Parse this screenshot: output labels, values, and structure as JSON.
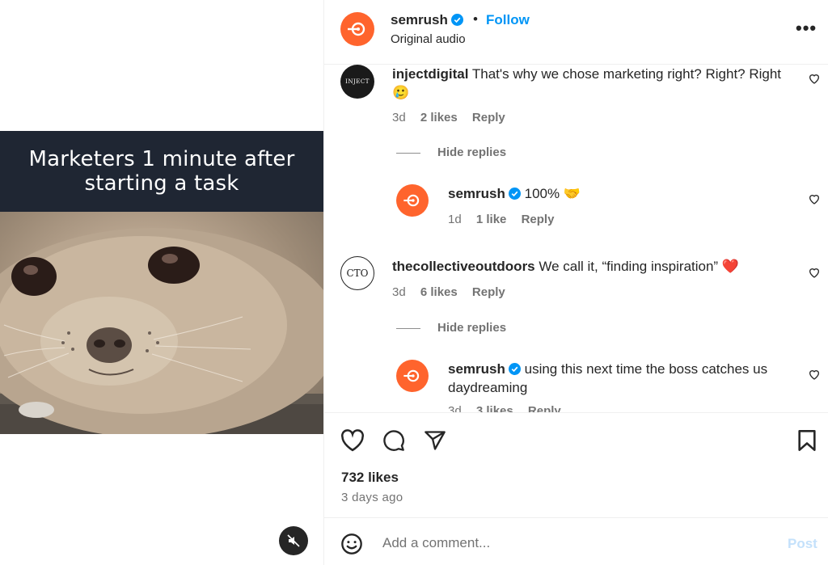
{
  "media": {
    "caption": "Marketers 1 minute after starting a task"
  },
  "header": {
    "username": "semrush",
    "separator": "•",
    "follow_label": "Follow",
    "subtitle": "Original audio",
    "more_label": "•••"
  },
  "comments": [
    {
      "username": "injectdigital",
      "avatar_text": "INJECT",
      "text": "That's why we chose marketing right? Right? Right 🥲",
      "time": "3d",
      "likes": "2 likes",
      "reply_label": "Reply",
      "hide_replies": "Hide replies",
      "replies": [
        {
          "username": "semrush",
          "text": "100% 🤝",
          "time": "1d",
          "likes": "1 like",
          "reply_label": "Reply"
        }
      ]
    },
    {
      "username": "thecollectiveoutdoors",
      "avatar_text": "CTO",
      "text": "We call it, “finding inspiration” ❤️",
      "time": "3d",
      "likes": "6 likes",
      "reply_label": "Reply",
      "hide_replies": "Hide replies",
      "replies": [
        {
          "username": "semrush",
          "text": "using this next time the boss catches us daydreaming",
          "time": "3d",
          "likes": "3 likes",
          "reply_label": "Reply"
        }
      ]
    }
  ],
  "post": {
    "likes": "732 likes",
    "ago": "3 days ago"
  },
  "add_comment": {
    "placeholder": "Add a comment...",
    "post_label": "Post"
  },
  "colors": {
    "brand": "#ff642d",
    "link": "#0095f6",
    "caption_band": "#1f2633"
  }
}
